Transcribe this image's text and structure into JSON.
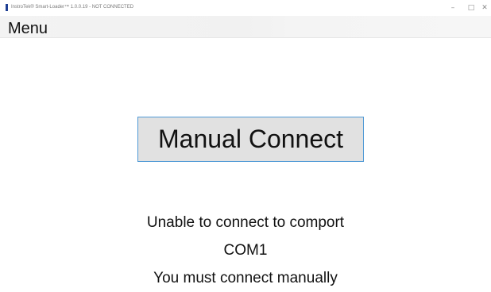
{
  "window": {
    "title": "InstroTek® Smart-Loader™ 1.0.0.19 - NOT CONNECTED",
    "controls": {
      "minimize": "–",
      "maximize": "□",
      "close": "✕"
    },
    "icon": "app-icon"
  },
  "menu": {
    "items": [
      {
        "label": "Menu"
      }
    ]
  },
  "main": {
    "connect_button_label": "Manual Connect",
    "status_lines": [
      "Unable to connect to comport",
      "COM1",
      "You must connect manually"
    ]
  },
  "colors": {
    "button_background": "#e1e1e1",
    "button_border": "#4f9ad6",
    "menu_bar": "#f2f2f2",
    "app_icon": "#1e3f94"
  }
}
